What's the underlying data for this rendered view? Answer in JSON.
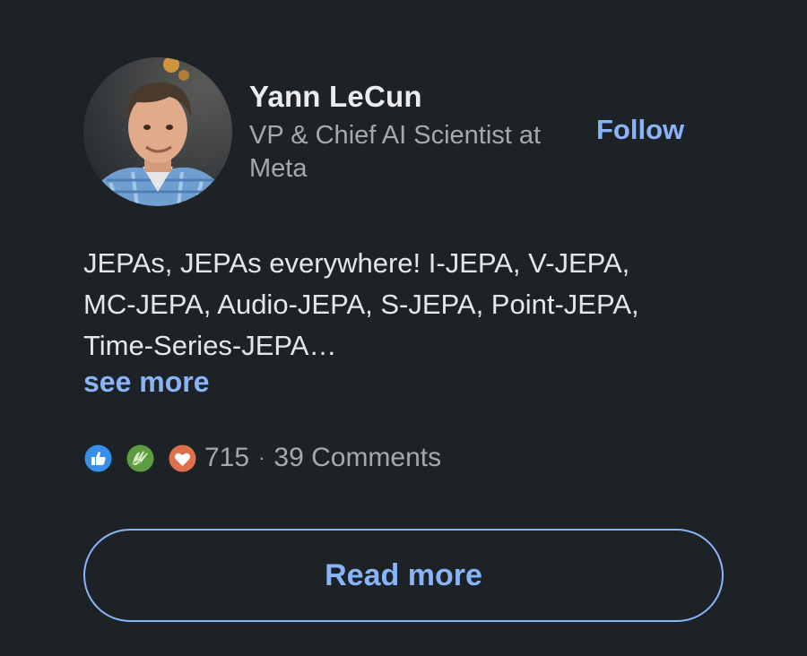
{
  "author": {
    "name": "Yann LeCun",
    "headline": "VP & Chief AI Scientist at Meta"
  },
  "follow_label": "Follow",
  "post": {
    "text": "JEPAs, JEPAs everywhere! I-JEPA, V-JEPA, MC-JEPA, Audio-JEPA, S-JEPA, Point-JEPA, Time-Series-JEPA…",
    "see_more_label": "see more"
  },
  "social": {
    "reactions": [
      "like-icon",
      "celebrate-icon",
      "love-icon"
    ],
    "reaction_count": "715",
    "separator": "·",
    "comments": "39 Comments"
  },
  "read_more_label": "Read more",
  "colors": {
    "background": "#1d2226",
    "accent": "#8ab4f8",
    "like": "#378fe9",
    "celebrate": "#5f9b41",
    "love": "#df704d"
  }
}
